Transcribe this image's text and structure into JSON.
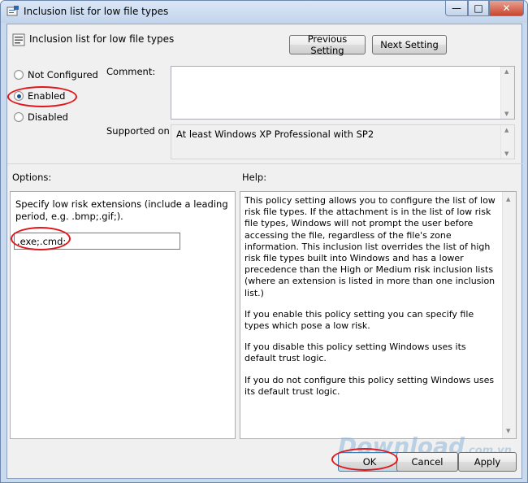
{
  "window": {
    "title": "Inclusion list for low file types",
    "minimize_glyph": "—",
    "maximize_glyph": "□",
    "close_glyph": "✕"
  },
  "header": {
    "policy_title": "Inclusion list for low file types",
    "previous_label": "Previous Setting",
    "next_label": "Next Setting"
  },
  "state": {
    "options": [
      {
        "label": "Not Configured",
        "checked": false
      },
      {
        "label": "Enabled",
        "checked": true
      },
      {
        "label": "Disabled",
        "checked": false
      }
    ]
  },
  "comment": {
    "label": "Comment:",
    "value": ""
  },
  "supported": {
    "label": "Supported on:",
    "value": "At least Windows XP Professional with SP2"
  },
  "options_section": {
    "label": "Options:",
    "prompt": "Specify low risk extensions (include a leading period, e.g. .bmp;.gif;).",
    "extensions_value": ".exe;.cmd;"
  },
  "help_section": {
    "label": "Help:",
    "paragraphs": [
      "This policy setting allows you to configure the list of low risk file types. If the attachment is in the list of low risk file types, Windows will not prompt the user before accessing the file, regardless of the file's zone information. This inclusion list overrides the list of high risk file types built into Windows and has a lower precedence than the High or Medium risk inclusion lists (where an extension is listed in more than one inclusion list.)",
      "If you enable this policy setting you can specify file types which pose a low risk.",
      "If you disable this policy setting Windows uses its default trust logic.",
      "If you do not configure this policy setting Windows uses its default trust logic."
    ]
  },
  "footer": {
    "ok_label": "OK",
    "cancel_label": "Cancel",
    "apply_label": "Apply"
  },
  "watermark": {
    "text": "Download",
    "suffix": ".com.vn"
  },
  "colors": {
    "annotation": "#e0161b",
    "title_bar": "#c9d9ee",
    "close_button": "#c9462c"
  }
}
